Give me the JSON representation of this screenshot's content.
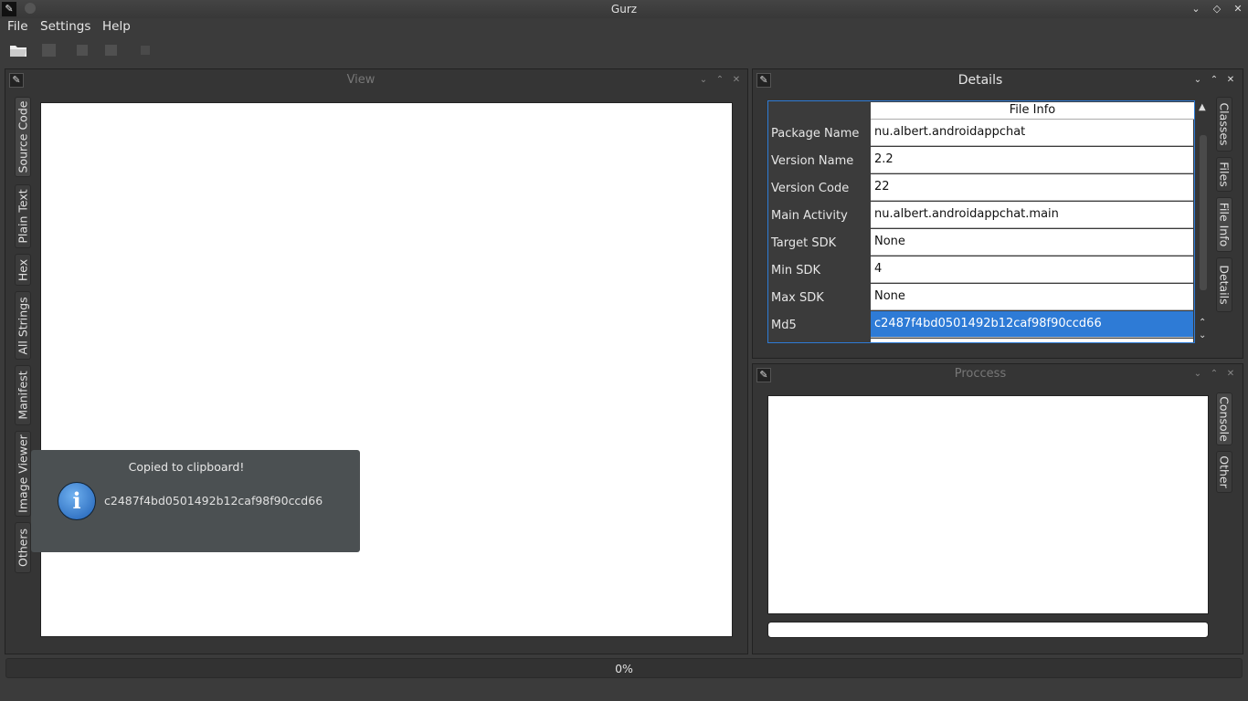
{
  "window": {
    "title": "Gurz"
  },
  "menu": [
    "File",
    "Settings",
    "Help"
  ],
  "view_dock": {
    "title": "View",
    "tabs": [
      "Source Code",
      "Plain Text",
      "Hex",
      "All Strings",
      "Manifest",
      "Image Viewer",
      "Others"
    ]
  },
  "details_dock": {
    "title": "Details",
    "header": "File Info",
    "rows": [
      {
        "label": "Package Name",
        "value": "nu.albert.androidappchat"
      },
      {
        "label": "Version Name",
        "value": "2.2"
      },
      {
        "label": "Version Code",
        "value": "22"
      },
      {
        "label": "Main Activity",
        "value": "nu.albert.androidappchat.main"
      },
      {
        "label": "Target SDK",
        "value": "None"
      },
      {
        "label": "Min SDK",
        "value": "4"
      },
      {
        "label": "Max SDK",
        "value": "None"
      },
      {
        "label": "Md5",
        "value": "c2487f4bd0501492b12caf98f90ccd66"
      }
    ],
    "tabs": [
      "Classes",
      "Files",
      "File Info",
      "Details"
    ],
    "selected_row_index": 7
  },
  "process_dock": {
    "title": "Proccess",
    "tabs": [
      "Console",
      "Other"
    ]
  },
  "notification": {
    "title": "Copied to clipboard!",
    "message": "c2487f4bd0501492b12caf98f90ccd66",
    "icon": "info-icon"
  },
  "statusbar": {
    "progress_text": "0%",
    "progress": 0
  },
  "colors": {
    "selection": "#2e7bd6",
    "background": "#3b3b3b",
    "toast": "#4b5052"
  }
}
